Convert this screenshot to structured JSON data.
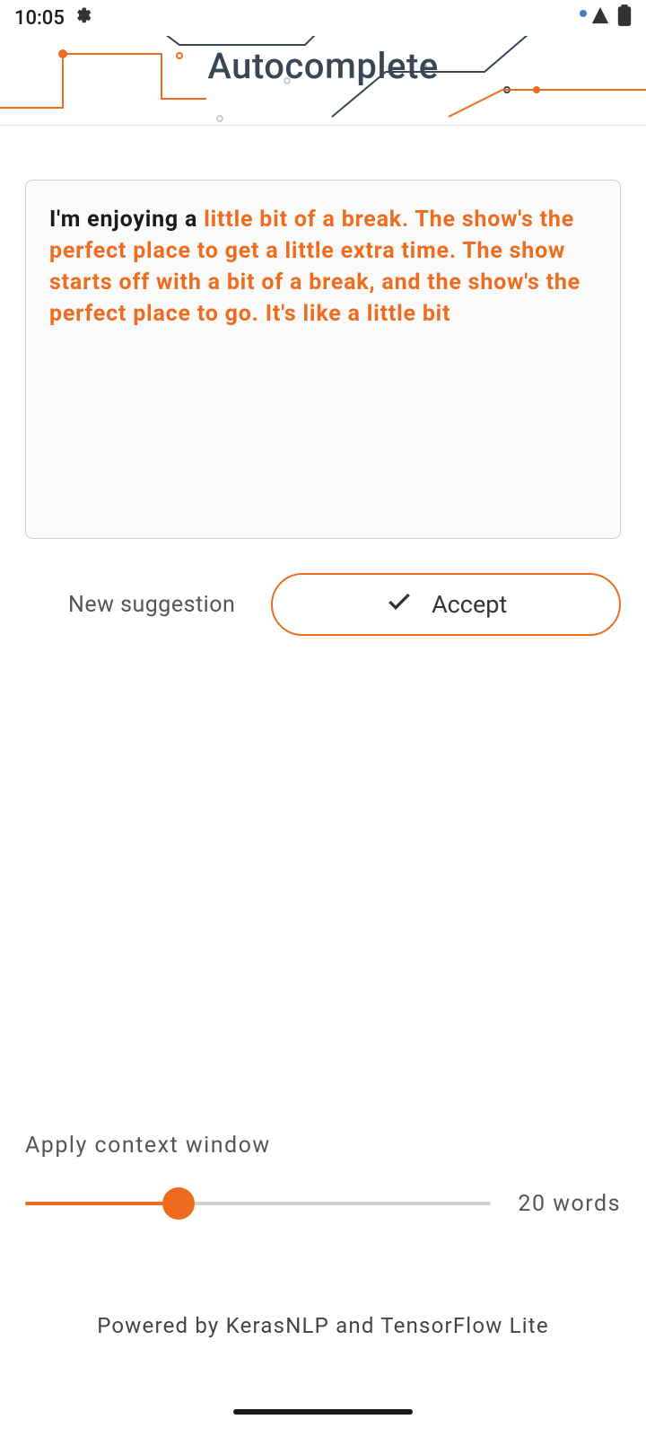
{
  "status": {
    "time": "10:05"
  },
  "header": {
    "title": "Autocomplete"
  },
  "textbox": {
    "user_text": "I'm enjoying a ",
    "suggestion": "little bit of a break. The show's the perfect place to get a little extra time. The show starts off with a bit of a break, and the show's the perfect place to go. It's like a little bit"
  },
  "buttons": {
    "new_suggestion": "New suggestion",
    "accept": "Accept"
  },
  "context": {
    "label": "Apply context window",
    "value_text": "20 words",
    "value": 20
  },
  "footer": {
    "text": "Powered by KerasNLP and TensorFlow Lite"
  },
  "colors": {
    "accent": "#ed6c1f"
  }
}
